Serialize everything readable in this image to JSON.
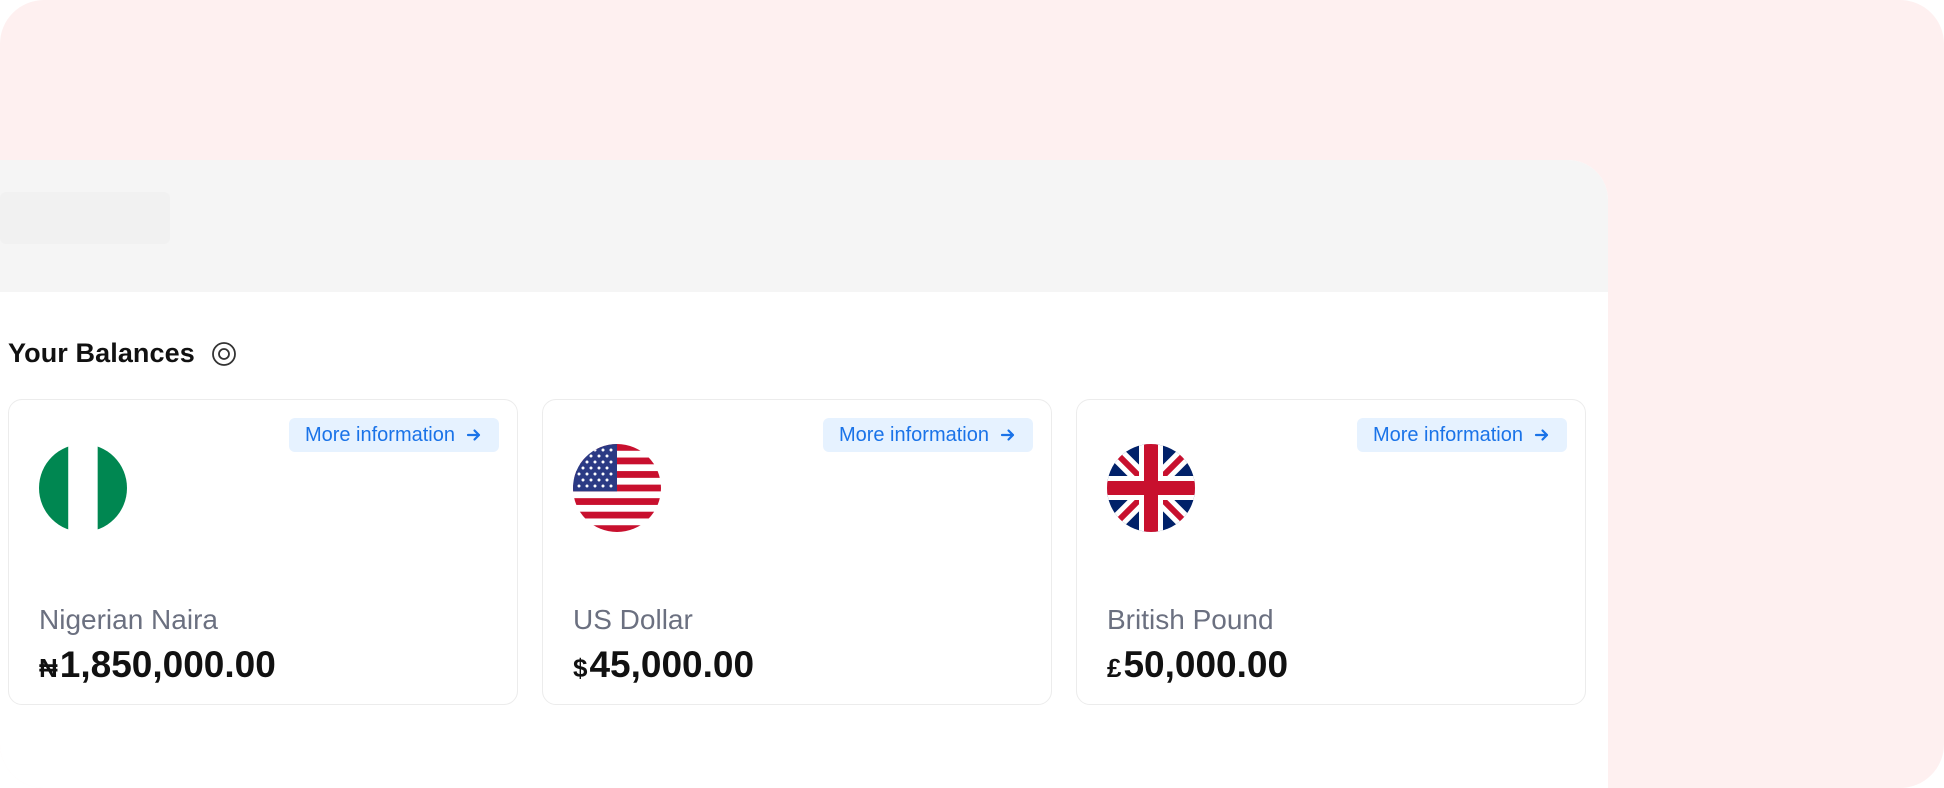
{
  "balances": {
    "title": "Your Balances",
    "toggle_icon": "eye-icon",
    "accounts": [
      {
        "flag_icon": "nigeria-flag-icon",
        "more_label": "More information",
        "currency_name": "Nigerian Naira",
        "symbol": "₦",
        "amount": "1,850,000.00"
      },
      {
        "flag_icon": "usa-flag-icon",
        "more_label": "More information",
        "currency_name": "US Dollar",
        "symbol": "$",
        "amount": "45,000.00"
      },
      {
        "flag_icon": "uk-flag-icon",
        "more_label": "More information",
        "currency_name": "British Pound",
        "symbol": "£",
        "amount": "50,000.00"
      }
    ]
  },
  "colors": {
    "background_pink": "#fef0f0",
    "header_gray": "#f5f5f5",
    "link_blue": "#1a73e8",
    "link_bg": "#e6f2ff"
  }
}
